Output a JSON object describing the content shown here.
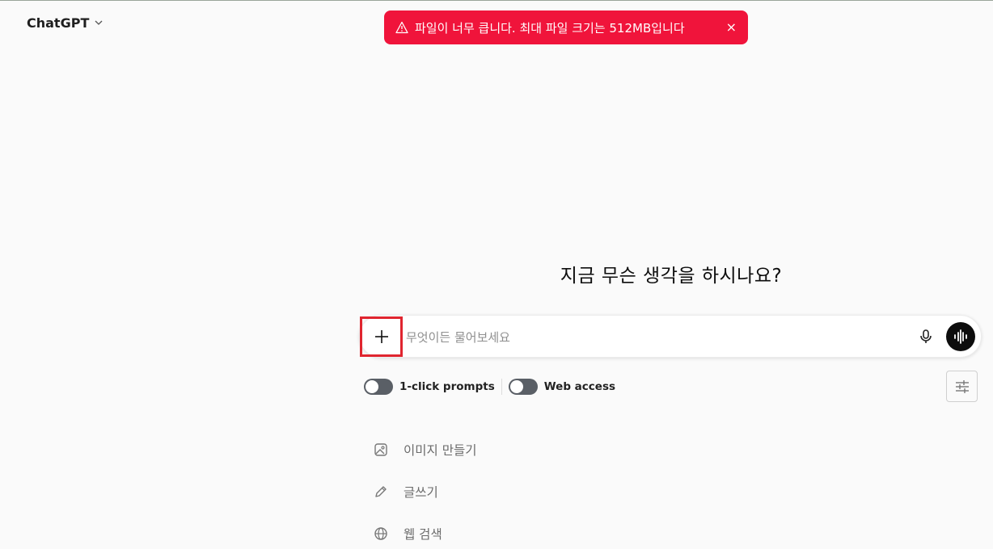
{
  "header": {
    "model_name": "ChatGPT"
  },
  "toast": {
    "message": "파일이 너무 큽니다. 최대 파일 크기는 512MB입니다",
    "close_label": "×",
    "color": "#f0143b"
  },
  "main": {
    "headline": "지금 무슨 생각을 하시나요?"
  },
  "composer": {
    "placeholder": "무엇이든 물어보세요",
    "value": ""
  },
  "toggles": {
    "one_click_label": "1-click prompts",
    "web_access_label": "Web access"
  },
  "suggestions": {
    "items": [
      {
        "label": "이미지 만들기",
        "icon": "image-icon"
      },
      {
        "label": "글쓰기",
        "icon": "pencil-icon"
      },
      {
        "label": "웹 검색",
        "icon": "globe-icon"
      }
    ]
  },
  "colors": {
    "background": "#fafafa",
    "highlight_box": "#e0252f",
    "toggle_off": "#5a5f66"
  }
}
